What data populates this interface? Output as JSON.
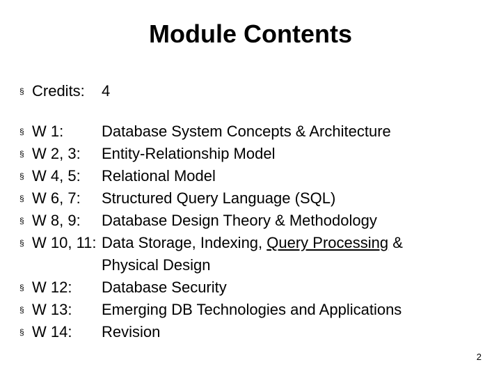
{
  "title": "Module Contents",
  "credits_label": "Credits:",
  "credits_value": "4",
  "rows": [
    {
      "label": "W 1:",
      "desc": "Database System Concepts & Architecture"
    },
    {
      "label": "W 2, 3:",
      "desc": "Entity-Relationship Model"
    },
    {
      "label": "W 4, 5:",
      "desc": "Relational Model"
    },
    {
      "label": "W 6, 7:",
      "desc": "Structured Query Language (SQL)"
    },
    {
      "label": "W 8, 9:",
      "desc": "Database Design Theory & Methodology"
    },
    {
      "label": "W 10, 11:",
      "desc_prefix": "Data Storage, Indexing, ",
      "desc_underlined": "Query Processing",
      "desc_suffix": " &"
    },
    {
      "label": "",
      "desc": "Physical Design",
      "no_bullet": true
    },
    {
      "label": "W 12:",
      "desc": "Database Security"
    },
    {
      "label": "W 13:",
      "desc": "Emerging DB Technologies and Applications"
    },
    {
      "label": "W 14:",
      "desc": "Revision"
    }
  ],
  "page_number": "2",
  "bullet_char": "§"
}
